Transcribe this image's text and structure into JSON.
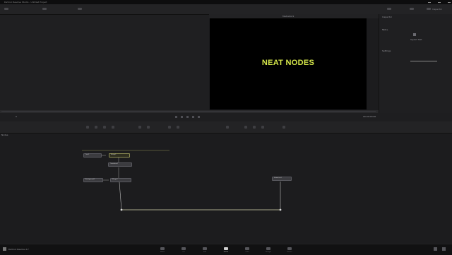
{
  "window": {
    "title": "DaVinci Resolve Studio - Untitled Project"
  },
  "toolbar": {
    "left_items": [
      "Media Pool",
      "Effects",
      "Nodes"
    ],
    "right_items": [
      "Spline",
      "Keyframes",
      "Metadata",
      "Inspector"
    ]
  },
  "viewer": {
    "tab_label": "MediaOut1",
    "title_text": "NEAT NODES",
    "title_color": "#d6e84a"
  },
  "inspector": {
    "header": "Inspector",
    "section_title": "Text+",
    "subsection": "Settings",
    "row_label": "Styled Text"
  },
  "transport": {
    "timecode": "00:00:00:00",
    "frame": "0"
  },
  "node_editor": {
    "label": "Nodes",
    "nodes": [
      {
        "name": "Text1"
      },
      {
        "name": "Merge1"
      },
      {
        "name": "Transform1"
      },
      {
        "name": "Background1"
      },
      {
        "name": "Merge2"
      },
      {
        "name": "MediaOut1"
      }
    ]
  },
  "statusbar": {
    "app_name": "DaVinci Resolve 17",
    "pages": [
      "Media",
      "Cut",
      "Edit",
      "Fusion",
      "Color",
      "Fairlight",
      "Deliver"
    ],
    "active_page": "Fusion"
  }
}
